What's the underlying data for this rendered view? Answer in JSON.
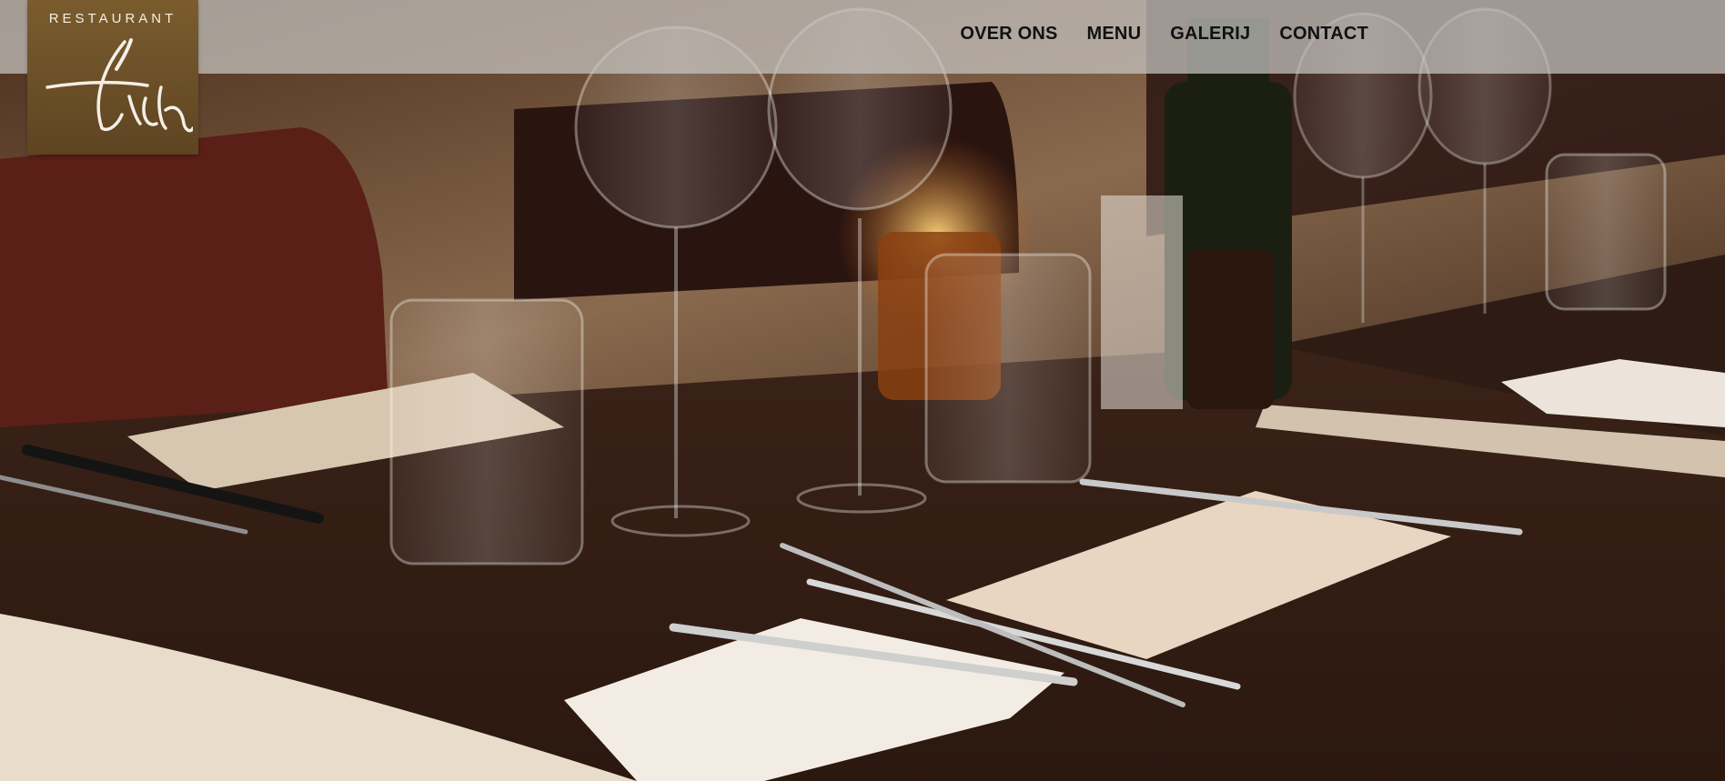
{
  "logo": {
    "wordmark": "RESTAURANT",
    "signature": "Flich"
  },
  "nav": {
    "items": [
      {
        "label": "OVER ONS"
      },
      {
        "label": "MENU"
      },
      {
        "label": "GALERIJ"
      },
      {
        "label": "CONTACT"
      }
    ]
  },
  "colors": {
    "topbar": "#c8c6c4",
    "logo_bg": "#6b4f28",
    "nav_text": "#111111"
  }
}
